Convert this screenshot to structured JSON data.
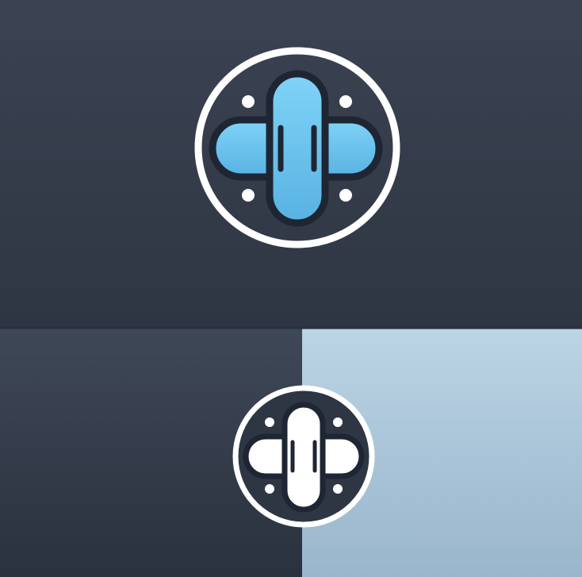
{
  "colors": {
    "background_dark": "#343c4a",
    "background_light": "#a8c3d7",
    "ring": "#ffffff",
    "cross_primary": "#6cc7ee",
    "cross_outline": "#1e2633",
    "cross_mono": "#ffffff",
    "dots": "#ffffff"
  },
  "icons": {
    "primary": "medical-cross-logo-icon",
    "monochrome": "medical-cross-logo-mono-icon"
  }
}
